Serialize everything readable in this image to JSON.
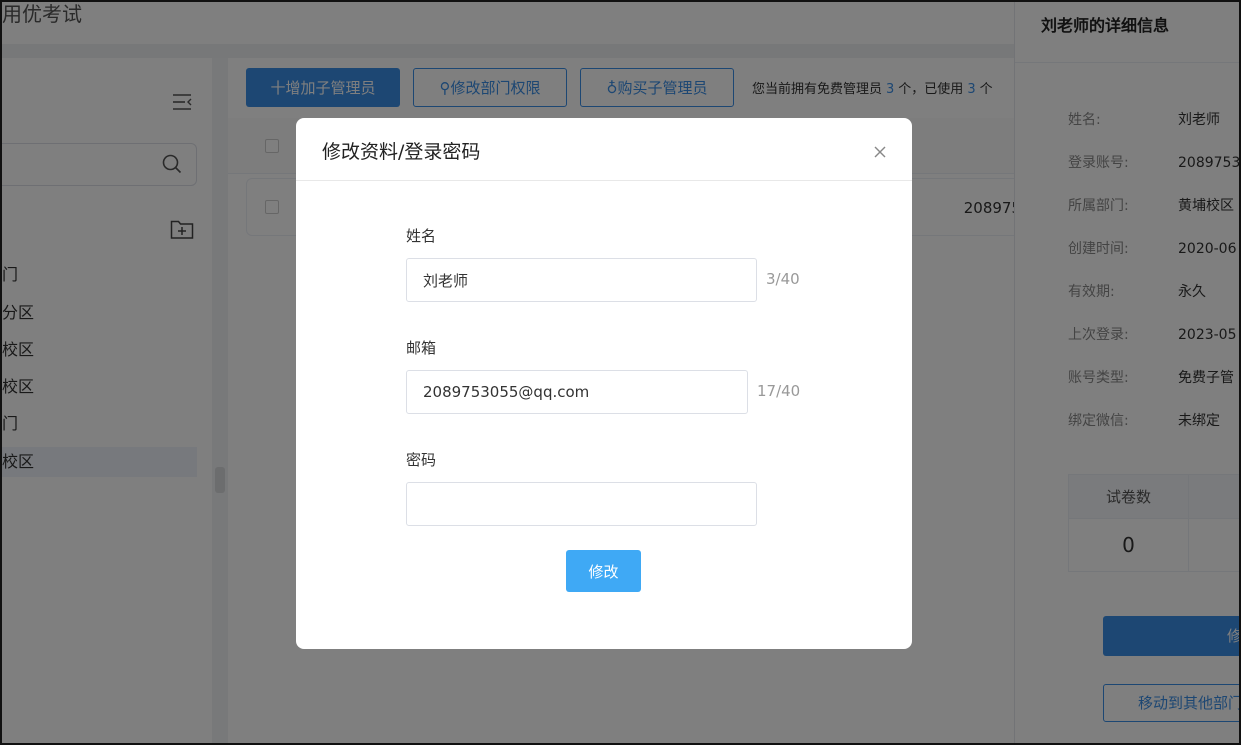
{
  "app": {
    "title": "用优考试"
  },
  "sidebar": {
    "tree": [
      {
        "label": "门",
        "active": false
      },
      {
        "label": "分区",
        "active": false
      },
      {
        "label": "校区",
        "active": false
      },
      {
        "label": "校区",
        "active": false
      },
      {
        "label": "门",
        "active": false
      },
      {
        "label": "校区",
        "active": true
      }
    ]
  },
  "toolbar": {
    "add_admin": "十增加子管理员",
    "edit_perm": "修改部门权限",
    "buy_admin": "购买子管理员",
    "info_prefix": "您当前拥有免费管理员",
    "info_count1": "3",
    "info_mid": "个，已使用",
    "info_count2": "3",
    "info_suffix": "个"
  },
  "table": {
    "row_account": "208975"
  },
  "drawer": {
    "title": "刘老师的详细信息",
    "fields": [
      {
        "label": "姓名:",
        "value": "刘老师"
      },
      {
        "label": "登录账号:",
        "value": "2089753"
      },
      {
        "label": "所属部门:",
        "value": "黄埔校区"
      },
      {
        "label": "创建时间:",
        "value": "2020-06"
      },
      {
        "label": "有效期:",
        "value": "永久"
      },
      {
        "label": "上次登录:",
        "value": "2023-05"
      },
      {
        "label": "账号类型:",
        "value": "免费子管"
      },
      {
        "label": "绑定微信:",
        "value": "未绑定"
      }
    ],
    "stat_label": "试卷数",
    "stat_value": "0",
    "btn_edit": "修",
    "btn_move": "移动到其他部门"
  },
  "modal": {
    "title": "修改资料/登录密码",
    "name_label": "姓名",
    "name_value": "刘老师",
    "name_count": "3/40",
    "email_label": "邮箱",
    "email_value": "2089753055@qq.com",
    "email_count": "17/40",
    "password_label": "密码",
    "password_value": "",
    "submit": "修改"
  }
}
